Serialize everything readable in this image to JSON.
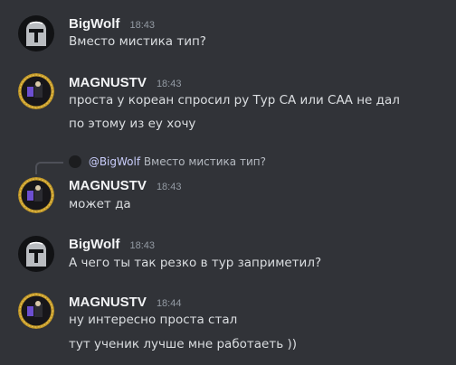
{
  "messages": [
    {
      "author": "BigWolf",
      "time": "18:43",
      "lines": [
        "Вместо мистика тип?"
      ],
      "avatar": "mandalorian-avatar"
    },
    {
      "author": "MAGNUSTV",
      "time": "18:43",
      "lines": [
        "проста у кореан спросил ру Тур СА или САА не дал",
        "по этому из еу хочу"
      ],
      "avatar": "magnus-avatar"
    },
    {
      "author": "MAGNUSTV",
      "time": "18:43",
      "lines": [
        "может да"
      ],
      "avatar": "magnus-avatar",
      "reply": {
        "author": "@BigWolf",
        "text": "Вместо мистика тип?"
      }
    },
    {
      "author": "BigWolf",
      "time": "18:43",
      "lines": [
        "А чего ты так резко в тур заприметил?"
      ],
      "avatar": "mandalorian-avatar"
    },
    {
      "author": "MAGNUSTV",
      "time": "18:44",
      "lines": [
        "ну интересно проста стал",
        "тут ученик лучше мне работаеть ))"
      ],
      "avatar": "magnus-avatar"
    }
  ],
  "colors": {
    "background": "#313338",
    "author": "#f2f3f5",
    "timestamp": "#949ba4",
    "text": "#dbdee1",
    "reply_author": "#c9cdfb"
  }
}
